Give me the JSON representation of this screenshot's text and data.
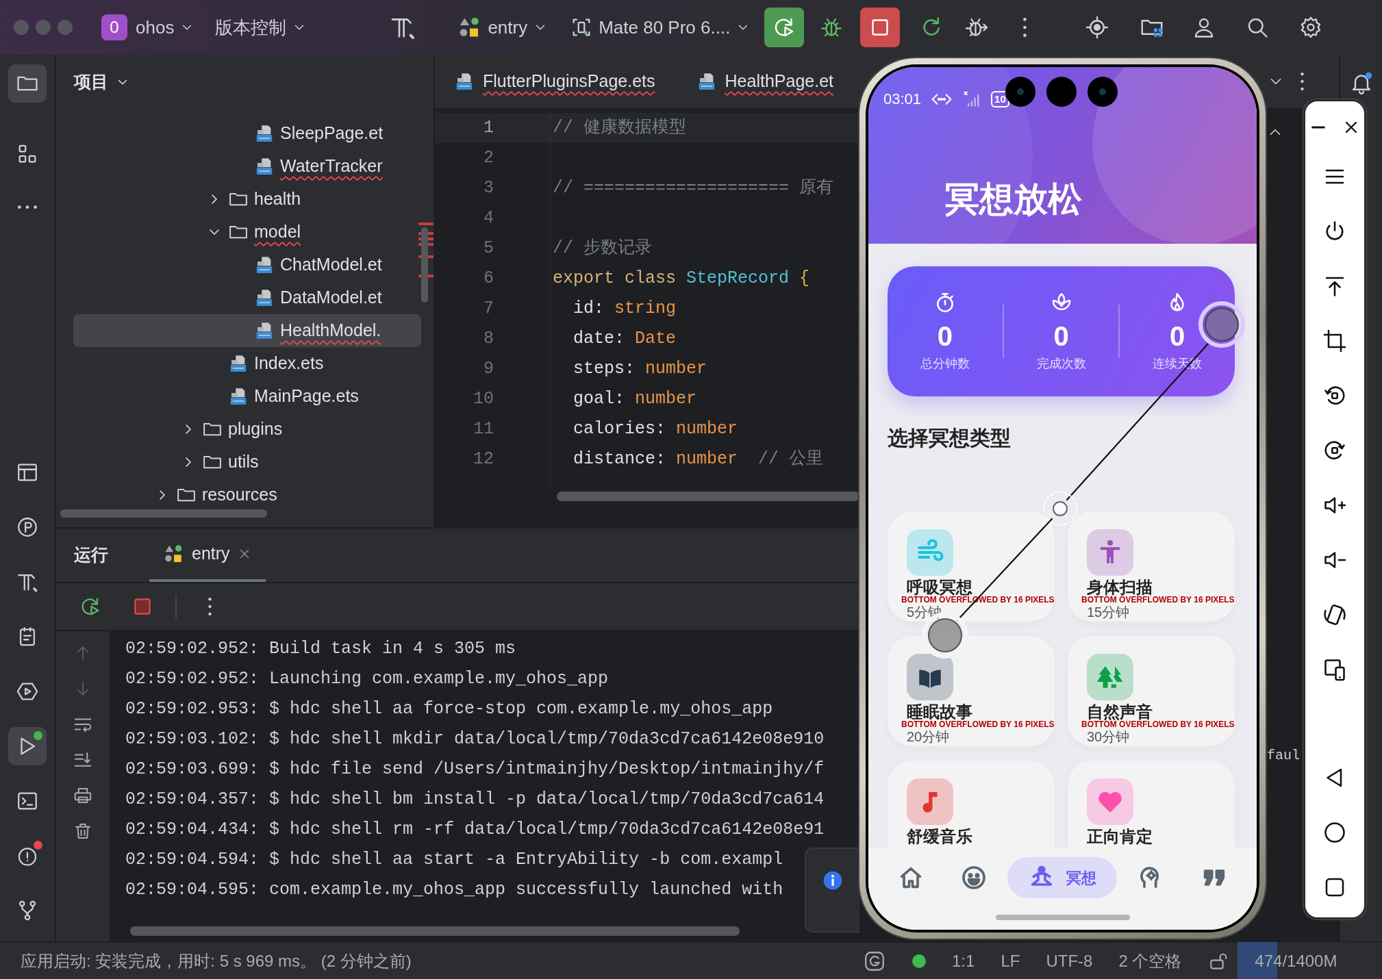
{
  "title_bar": {
    "project_badge": "0",
    "project": "ohos",
    "vcs": "版本控制",
    "run_config": "entry",
    "device": "Mate 80 Pro 6...."
  },
  "activity_bar": {
    "top": [
      {
        "selected": true
      },
      {
        "selected": false
      },
      {
        "selected": false
      }
    ],
    "bottom": [
      {
        "selected": false
      },
      {
        "selected": false
      },
      {
        "selected": false
      },
      {
        "selected": false
      },
      {
        "selected": false
      },
      {
        "selected": true
      },
      {
        "selected": false
      },
      {
        "selected": false
      },
      {
        "selected": false
      }
    ]
  },
  "project_panel": {
    "title": "项目",
    "tree": [
      {
        "children": [
          {
            "children": [
              {
                "children": [
                  {
                    "kind": "file",
                    "label": "SleepPage.et",
                    "selected": false,
                    "has_errors": false
                  },
                  {
                    "kind": "file",
                    "label": "WaterTracker",
                    "selected": false,
                    "has_errors": true
                  }
                ]
              },
              {
                "kind": "folder",
                "label": "health",
                "expanded": false,
                "selected": false,
                "has_errors": false
              },
              {
                "kind": "folder",
                "label": "model",
                "expanded": true,
                "selected": false,
                "has_errors": true,
                "children": [
                  {
                    "kind": "file",
                    "label": "ChatModel.et",
                    "selected": false,
                    "has_errors": false
                  },
                  {
                    "kind": "file",
                    "label": "DataModel.et",
                    "selected": false,
                    "has_errors": false
                  },
                  {
                    "kind": "file",
                    "label": "HealthModel.",
                    "selected": true,
                    "has_errors": true
                  }
                ]
              },
              {
                "kind": "file",
                "label": "Index.ets",
                "selected": false,
                "has_errors": false
              },
              {
                "kind": "file",
                "label": "MainPage.ets",
                "selected": false,
                "has_errors": false
              }
            ]
          },
          {
            "kind": "folder",
            "label": "plugins",
            "expanded": false,
            "selected": false,
            "has_errors": false
          },
          {
            "kind": "folder",
            "label": "utils",
            "expanded": false,
            "selected": false,
            "has_errors": false
          }
        ]
      },
      {
        "kind": "folder",
        "label": "resources",
        "expanded": false,
        "selected": false,
        "has_errors": false
      }
    ]
  },
  "editor": {
    "tabs": [
      {
        "label": "FlutterPluginsPage.ets",
        "has_errors": true
      },
      {
        "label": "HealthPage.et",
        "has_errors": true
      }
    ],
    "lines": [
      {
        "number": "1",
        "current": true,
        "tokens": [
          {
            "kind": "comment",
            "text": "// 健康数据模型"
          }
        ]
      },
      {
        "number": "2",
        "current": false
      },
      {
        "number": "3",
        "current": false,
        "tokens": [
          {
            "kind": "comment",
            "text": "// ==================== 原有"
          }
        ]
      },
      {
        "number": "4",
        "current": false
      },
      {
        "number": "5",
        "current": false,
        "tokens": [
          {
            "kind": "comment",
            "text": "// 步数记录"
          }
        ]
      },
      {
        "number": "6",
        "current": false,
        "tokens": [
          {
            "kind": "keyword",
            "text": "export class "
          },
          {
            "kind": "class",
            "text": "StepRecord "
          },
          {
            "kind": "brace",
            "text": "{"
          }
        ]
      },
      {
        "number": "7",
        "current": false,
        "tokens": [
          {
            "kind": "field",
            "text": "  id"
          },
          {
            "kind": "punct",
            "text": ": "
          },
          {
            "kind": "type",
            "text": "string"
          }
        ]
      },
      {
        "number": "8",
        "current": false,
        "tokens": [
          {
            "kind": "field",
            "text": "  date"
          },
          {
            "kind": "punct",
            "text": ": "
          },
          {
            "kind": "type",
            "text": "Date"
          }
        ]
      },
      {
        "number": "9",
        "current": false,
        "tokens": [
          {
            "kind": "field",
            "text": "  steps"
          },
          {
            "kind": "punct",
            "text": ": "
          },
          {
            "kind": "type",
            "text": "number"
          }
        ]
      },
      {
        "number": "10",
        "current": false,
        "tokens": [
          {
            "kind": "field",
            "text": "  goal"
          },
          {
            "kind": "punct",
            "text": ": "
          },
          {
            "kind": "type",
            "text": "number"
          }
        ]
      },
      {
        "number": "11",
        "current": false,
        "tokens": [
          {
            "kind": "field",
            "text": "  calories"
          },
          {
            "kind": "punct",
            "text": ": "
          },
          {
            "kind": "type",
            "text": "number"
          }
        ]
      },
      {
        "number": "12",
        "current": false,
        "tokens": [
          {
            "kind": "field",
            "text": "  distance"
          },
          {
            "kind": "punct",
            "text": ": "
          },
          {
            "kind": "type",
            "text": "number"
          },
          {
            "kind": "comment",
            "text": "  // 公里"
          }
        ]
      }
    ]
  },
  "run_panel": {
    "title": "运行",
    "tabs": [
      {
        "label": "entry",
        "selected": true
      }
    ],
    "console": [
      "02:59:02.952: Build task in 4 s 305 ms",
      "02:59:02.952: Launching com.example.my_ohos_app",
      "02:59:02.953: $ hdc shell aa force-stop com.example.my_ohos_app",
      "02:59:03.102: $ hdc shell mkdir data/local/tmp/70da3cd7ca6142e08e910",
      "02:59:03.699: $ hdc file send /Users/intmainjhy/Desktop/intmainjhy/f",
      "02:59:04.357: $ hdc shell bm install -p data/local/tmp/70da3cd7ca614",
      "02:59:04.434: $ hdc shell rm -rf data/local/tmp/70da3cd7ca6142e08e91",
      "02:59:04.594: $ hdc shell aa start -a EntryAbility -b com.exampl",
      "02:59:04.595: com.example.my_ohos_app successfully launched with"
    ],
    "console_fragment": "faul"
  },
  "status_bar": {
    "message": "应用启动: 安装完成，用时: 5 s 969 ms。 (2 分钟之前)",
    "position": "1:1",
    "line_ending": "LF",
    "encoding": "UTF-8",
    "indent": "2 个空格",
    "memory": {
      "reading": "474/1400M",
      "level": 0.34
    }
  },
  "phone": {
    "time": "03:01",
    "battery": "10",
    "title": "冥想放松",
    "stats": [
      {
        "value": "0",
        "label": "总分钟数"
      },
      {
        "value": "0",
        "label": "完成次数"
      },
      {
        "value": "0",
        "label": "连续天数"
      }
    ],
    "section_title": "选择冥想类型",
    "sessions": [
      {
        "title": "呼吸冥想",
        "warning": "BOTTOM OVERFLOWED BY 16 PIXELS",
        "duration": "5分钟",
        "color": "#19c4e0"
      },
      {
        "title": "身体扫描",
        "warning": "BOTTOM OVERFLOWED BY 16 PIXELS",
        "duration": "15分钟",
        "color": "#9c4fb8"
      },
      {
        "title": "睡眠故事",
        "warning": "BOTTOM OVERFLOWED BY 16 PIXELS",
        "duration": "20分钟",
        "color": "#263a50"
      },
      {
        "title": "自然声音",
        "warning": "BOTTOM OVERFLOWED BY 16 PIXELS",
        "duration": "30分钟",
        "color": "#0ba04a"
      },
      {
        "title": "舒缓音乐",
        "color": "#e5342e"
      },
      {
        "title": "正向肯定",
        "color": "#ff4fae"
      }
    ],
    "nav": [
      {
        "selected": false
      },
      {
        "selected": false
      },
      {
        "selected": true,
        "label": "冥想"
      },
      {
        "selected": false
      },
      {
        "selected": false
      }
    ]
  }
}
